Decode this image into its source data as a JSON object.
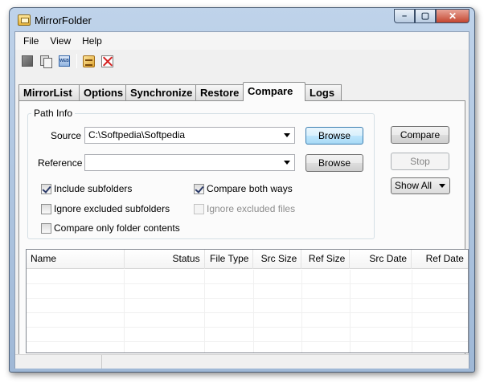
{
  "window": {
    "title": "MirrorFolder",
    "buttons": {
      "minimize": "–",
      "maximize": "▢",
      "close": "✕"
    }
  },
  "menu": {
    "items": [
      {
        "id": "file",
        "label": "File"
      },
      {
        "id": "view",
        "label": "View"
      },
      {
        "id": "help",
        "label": "Help"
      }
    ]
  },
  "toolbar": {
    "icons": [
      "edit-icon",
      "copy-icon",
      "web-icon",
      "synchronize-icon",
      "delete-icon"
    ],
    "web_icon_text": "WEB"
  },
  "tabs": [
    {
      "label": "MirrorList",
      "active": false
    },
    {
      "label": "Options",
      "active": false
    },
    {
      "label": "Synchronize",
      "active": false
    },
    {
      "label": "Restore",
      "active": false
    },
    {
      "label": "Compare",
      "active": true
    },
    {
      "label": "Logs",
      "active": false
    }
  ],
  "compare": {
    "group_title": "Path Info",
    "source_label": "Source",
    "source_value": "C:\\Softpedia\\Softpedia",
    "reference_label": "Reference",
    "reference_value": "",
    "browse_label": "Browse",
    "compare_label": "Compare",
    "stop_label": "Stop",
    "filter_value": "Show All",
    "options": {
      "include_subfolders": {
        "label": "Include subfolders",
        "checked": true
      },
      "compare_both_ways": {
        "label": "Compare both ways",
        "checked": true
      },
      "ignore_excluded_subfolders": {
        "label": "Ignore excluded subfolders",
        "checked": false
      },
      "ignore_excluded_files": {
        "label": "Ignore excluded files",
        "checked": false,
        "disabled": true
      },
      "compare_only_folder_contents": {
        "label": "Compare only folder contents",
        "checked": false
      }
    }
  },
  "results": {
    "columns": [
      "Name",
      "Status",
      "File Type",
      "Src Size",
      "Ref Size",
      "Src Date",
      "Ref Date"
    ],
    "rows": []
  },
  "colors": {
    "focus_border": "#3c7fb1",
    "window_frame": "#9fb8d6",
    "close_button": "#c4452f"
  }
}
